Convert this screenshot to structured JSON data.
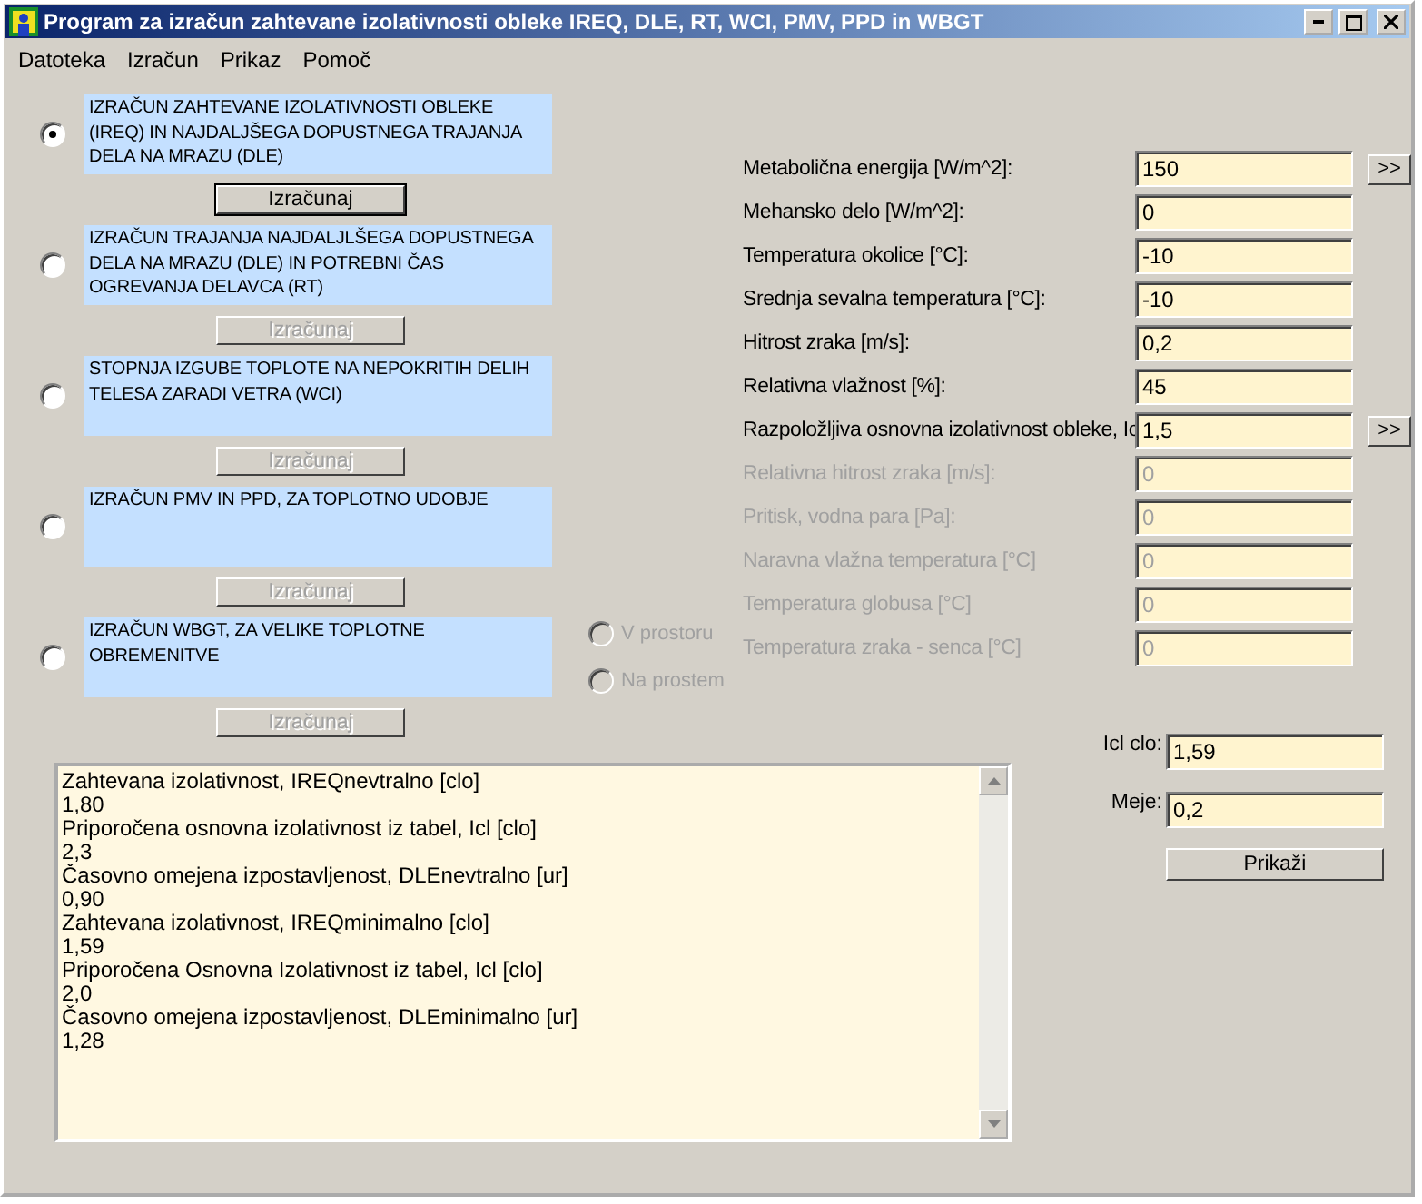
{
  "window": {
    "title": "Program za izračun zahtevane izolativnosti obleke IREQ, DLE, RT, WCI, PMV, PPD in WBGT"
  },
  "menu": [
    "Datoteka",
    "Izračun",
    "Prikaz",
    "Pomoč"
  ],
  "options": [
    {
      "label": "IZRAČUN ZAHTEVANE IZOLATIVNOSTI OBLEKE (IREQ) IN NAJDALJŠEGA DOPUSTNEGA TRAJANJA DELA NA MRAZU (DLE)",
      "selected": true,
      "button": {
        "label": "Izračunaj",
        "disabled": false
      }
    },
    {
      "label": "IZRAČUN TRAJANJA NAJDALJLŠEGA DOPUSTNEGA DELA NA MRAZU (DLE) IN POTREBNI ČAS OGREVANJA DELAVCA (RT)",
      "selected": false,
      "button": {
        "label": "Izračunaj",
        "disabled": true
      }
    },
    {
      "label": "STOPNJA IZGUBE TOPLOTE NA NEPOKRITIH DELIH TELESA ZARADI VETRA (WCI)",
      "selected": false,
      "button": {
        "label": "Izračunaj",
        "disabled": true
      }
    },
    {
      "label": "IZRAČUN PMV IN PPD, ZA TOPLOTNO UDOBJE",
      "selected": false,
      "button": {
        "label": "Izračunaj",
        "disabled": true
      }
    },
    {
      "label": "IZRAČUN WBGT, ZA VELIKE TOPLOTNE OBREMENITVE",
      "selected": false,
      "button": {
        "label": "Izračunaj",
        "disabled": true
      },
      "sub_options": [
        {
          "label": "V prostoru",
          "selected": false,
          "disabled": true
        },
        {
          "label": "Na prostem",
          "selected": false,
          "disabled": true
        }
      ]
    }
  ],
  "inputs": [
    {
      "label": "Metabolična energija [W/m^2]:",
      "value": "150",
      "disabled": false,
      "more_button": ">>"
    },
    {
      "label": "Mehansko delo [W/m^2]:",
      "value": "0",
      "disabled": false
    },
    {
      "label": "Temperatura okolice [°C]:",
      "value": "-10",
      "disabled": false
    },
    {
      "label": "Srednja sevalna temperatura [°C]:",
      "value": "-10",
      "disabled": false
    },
    {
      "label": "Hitrost zraka [m/s]:",
      "value": "0,2",
      "disabled": false
    },
    {
      "label": "Relativna vlažnost [%]:",
      "value": "45",
      "disabled": false
    },
    {
      "label": "Razpoložljiva osnovna izolativnost obleke, Ic",
      "value": "1,5",
      "disabled": false,
      "more_button": ">>"
    },
    {
      "label": "Relativna hitrost zraka [m/s]:",
      "value": "0",
      "disabled": true
    },
    {
      "label": "Pritisk, vodna para [Pa]:",
      "value": "0",
      "disabled": true
    },
    {
      "label": "Naravna vlažna temperatura [°C]",
      "value": "0",
      "disabled": true
    },
    {
      "label": "Temperatura globusa [°C]",
      "value": "0",
      "disabled": true
    },
    {
      "label": "Temperatura zraka - senca  [°C]",
      "value": "0",
      "disabled": true
    }
  ],
  "results": [
    "Zahtevana izolativnost, IREQnevtralno [clo]",
    "1,80",
    "Priporočena osnovna izolativnost iz tabel, Icl [clo]",
    "2,3",
    "Časovno omejena izpostavljenost, DLEnevtralno [ur]",
    "0,90",
    "Zahtevana izolativnost, IREQminimalno [clo]",
    "1,59",
    "Priporočena Osnovna Izolativnost iz tabel, Icl [clo]",
    "2,0",
    "Časovno omejena izpostavljenost, DLEminimalno [ur]",
    "1,28"
  ],
  "display_fields": [
    {
      "label": "Icl clo:",
      "value": "1,59"
    },
    {
      "label": "Meje:",
      "value": "0,2"
    }
  ],
  "show_button": "Prikaži"
}
